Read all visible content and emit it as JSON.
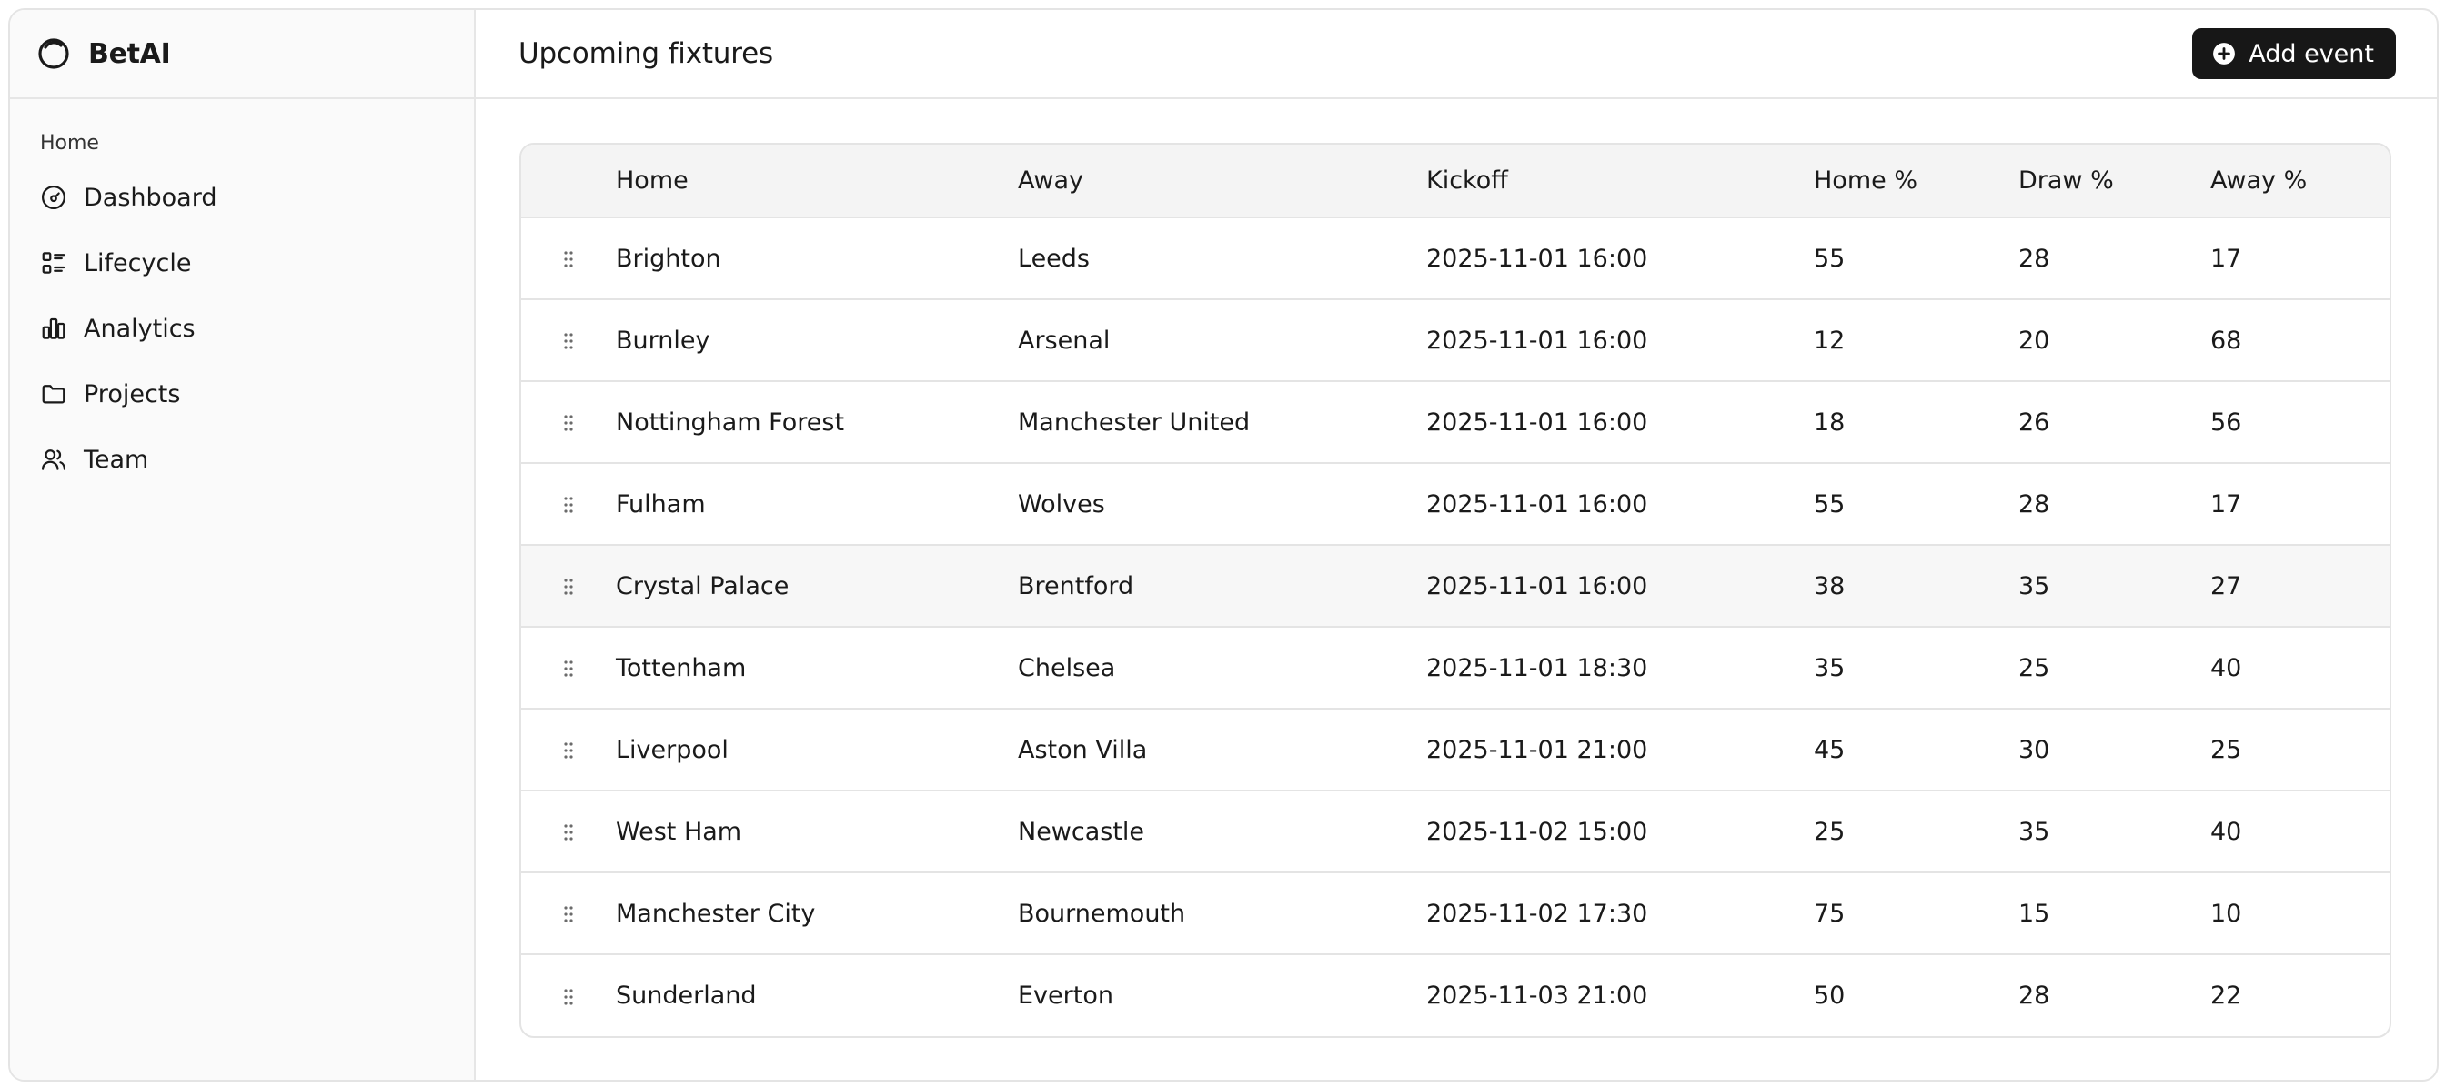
{
  "app": {
    "name": "BetAI"
  },
  "sidebar": {
    "group_label": "Home",
    "items": [
      {
        "label": "Dashboard",
        "icon": "gauge-icon"
      },
      {
        "label": "Lifecycle",
        "icon": "list-checks-icon"
      },
      {
        "label": "Analytics",
        "icon": "bar-chart-icon"
      },
      {
        "label": "Projects",
        "icon": "folder-icon"
      },
      {
        "label": "Team",
        "icon": "users-icon"
      }
    ]
  },
  "header": {
    "title": "Upcoming fixtures",
    "add_button_label": "Add event"
  },
  "table": {
    "columns": [
      "Home",
      "Away",
      "Kickoff",
      "Home %",
      "Draw %",
      "Away %"
    ],
    "rows": [
      {
        "home": "Brighton",
        "away": "Leeds",
        "kickoff": "2025-11-01 16:00",
        "home_pct": "55",
        "draw_pct": "28",
        "away_pct": "17"
      },
      {
        "home": "Burnley",
        "away": "Arsenal",
        "kickoff": "2025-11-01 16:00",
        "home_pct": "12",
        "draw_pct": "20",
        "away_pct": "68"
      },
      {
        "home": "Nottingham Forest",
        "away": "Manchester United",
        "kickoff": "2025-11-01 16:00",
        "home_pct": "18",
        "draw_pct": "26",
        "away_pct": "56"
      },
      {
        "home": "Fulham",
        "away": "Wolves",
        "kickoff": "2025-11-01 16:00",
        "home_pct": "55",
        "draw_pct": "28",
        "away_pct": "17"
      },
      {
        "home": "Crystal Palace",
        "away": "Brentford",
        "kickoff": "2025-11-01 16:00",
        "home_pct": "38",
        "draw_pct": "35",
        "away_pct": "27"
      },
      {
        "home": "Tottenham",
        "away": "Chelsea",
        "kickoff": "2025-11-01 18:30",
        "home_pct": "35",
        "draw_pct": "25",
        "away_pct": "40"
      },
      {
        "home": "Liverpool",
        "away": "Aston Villa",
        "kickoff": "2025-11-01 21:00",
        "home_pct": "45",
        "draw_pct": "30",
        "away_pct": "25"
      },
      {
        "home": "West Ham",
        "away": "Newcastle",
        "kickoff": "2025-11-02 15:00",
        "home_pct": "25",
        "draw_pct": "35",
        "away_pct": "40"
      },
      {
        "home": "Manchester City",
        "away": "Bournemouth",
        "kickoff": "2025-11-02 17:30",
        "home_pct": "75",
        "draw_pct": "15",
        "away_pct": "10"
      },
      {
        "home": "Sunderland",
        "away": "Everton",
        "kickoff": "2025-11-03 21:00",
        "home_pct": "50",
        "draw_pct": "28",
        "away_pct": "22"
      }
    ]
  },
  "colors": {
    "accent": "#171717",
    "sidebar_bg": "#fafafa",
    "border": "#e4e4e4",
    "header_row_bg": "#f4f4f4"
  }
}
